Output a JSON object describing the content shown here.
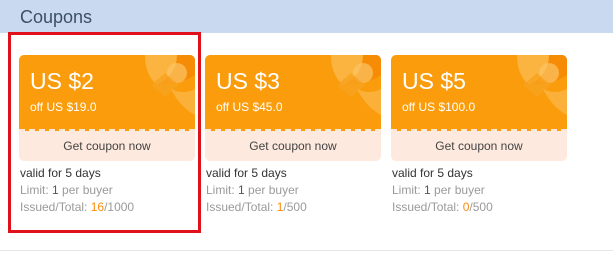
{
  "section": {
    "title": "Coupons"
  },
  "coupons": [
    {
      "amount": "US $2",
      "condition": "off US $19.0",
      "button_label": "Get coupon now",
      "validity": "valid for 5 days",
      "limit_label": "Limit:",
      "limit_value": "1",
      "limit_suffix": "per buyer",
      "issued_label": "Issued/Total:",
      "issued_value": "16",
      "total_value": "/1000"
    },
    {
      "amount": "US $3",
      "condition": "off US $45.0",
      "button_label": "Get coupon now",
      "validity": "valid for 5 days",
      "limit_label": "Limit:",
      "limit_value": "1",
      "limit_suffix": "per buyer",
      "issued_label": "Issued/Total:",
      "issued_value": "1",
      "total_value": "/500"
    },
    {
      "amount": "US $5",
      "condition": "off US $100.0",
      "button_label": "Get coupon now",
      "validity": "valid for 5 days",
      "limit_label": "Limit:",
      "limit_value": "1",
      "limit_suffix": "per buyer",
      "issued_label": "Issued/Total:",
      "issued_value": "0",
      "total_value": "/500"
    }
  ],
  "colors": {
    "coupon_orange": "#fa9c0b",
    "coupon_button_bg": "#fde9de",
    "header_bg": "#c9daf0",
    "highlight_red": "#e0111a",
    "issued_accent": "#fa8c0b"
  }
}
